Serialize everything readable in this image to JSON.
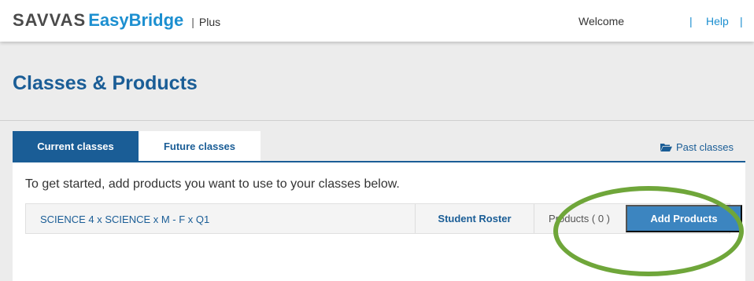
{
  "header": {
    "brand_main": "SAVVAS",
    "brand_sub": "EasyBridge",
    "brand_separator": "|",
    "brand_plus": "Plus",
    "welcome": "Welcome",
    "help_separator": "|",
    "help": "Help"
  },
  "page": {
    "title": "Classes & Products"
  },
  "tabs": [
    {
      "label": "Current classes",
      "active": true
    },
    {
      "label": "Future classes",
      "active": false
    }
  ],
  "past_classes": {
    "label": "Past classes",
    "icon": "folder-icon"
  },
  "panel": {
    "intro": "To get started, add products you want to use to your classes below."
  },
  "class_rows": [
    {
      "name": "SCIENCE 4 x SCIENCE x M - F x Q1",
      "roster_label": "Student Roster",
      "products_label": "Products ( 0 )",
      "add_label": "Add Products"
    }
  ],
  "colors": {
    "brand_blue": "#1a5d96",
    "link_blue": "#1c8fd0",
    "button_blue": "#3c85c0",
    "highlight_green": "#6fa63a"
  }
}
